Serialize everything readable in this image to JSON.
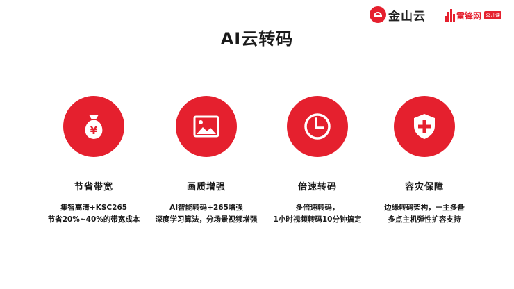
{
  "logos": {
    "kingsoft": {
      "name": "金山云",
      "icon": "kingsoft-cloud-icon"
    },
    "leiphone": {
      "name": "雷锋网",
      "badge": "公开课",
      "icon": "leiphone-bars-icon"
    }
  },
  "title": "AI云转码",
  "colors": {
    "accent": "#e5202e",
    "text": "#1a1a1a",
    "background": "#ffffff"
  },
  "features": [
    {
      "icon": "money-bag-icon",
      "title": "节省带宽",
      "desc": [
        "集智高清+KSC265",
        "节省20%~40%的带宽成本"
      ]
    },
    {
      "icon": "image-icon",
      "title": "画质增强",
      "desc": [
        "AI智能转码+265增强",
        "深度学习算法，分场景视频增强"
      ]
    },
    {
      "icon": "clock-icon",
      "title": "倍速转码",
      "desc": [
        "多倍速转码，",
        "1小时视频转码10分钟搞定"
      ]
    },
    {
      "icon": "shield-plus-icon",
      "title": "容灾保障",
      "desc": [
        "边缘转码架构，一主多备",
        "多点主机弹性扩容支持"
      ]
    }
  ]
}
